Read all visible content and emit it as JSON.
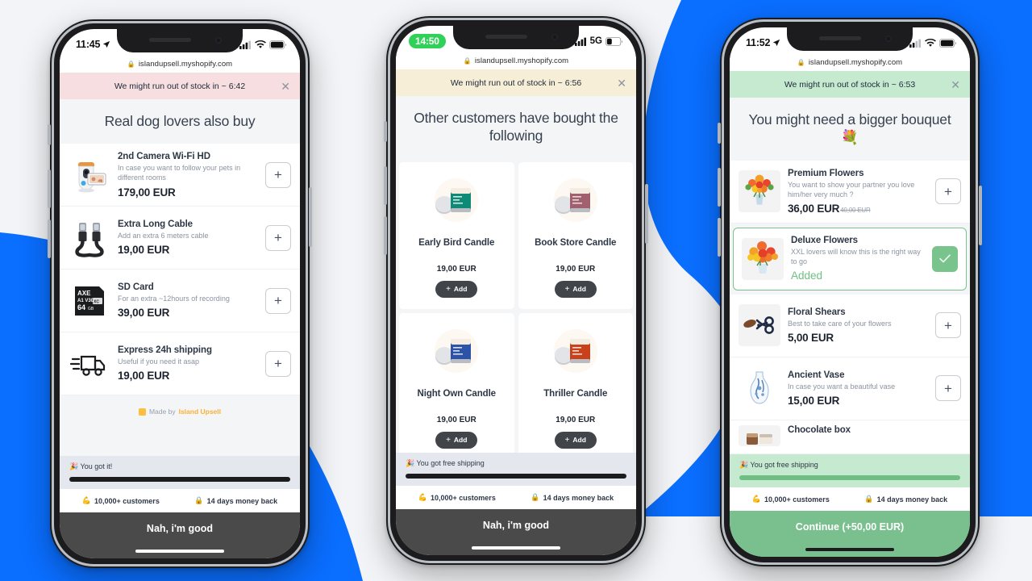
{
  "background": {
    "accent_color": "#0a6eff",
    "page_color": "#f2f4f7"
  },
  "phones": [
    {
      "id": "phone-left",
      "status_bar": {
        "time": "11:45",
        "time_style": "plain",
        "network": "wifi",
        "carrier_label": ""
      },
      "url": "islandupsell.myshopify.com",
      "banner": {
        "text": "We might run out of stock in ~ 6:42",
        "close_label": "✕",
        "color": "#f7dee0"
      },
      "title": "Real dog lovers also buy",
      "layout": "list",
      "items": [
        {
          "name": "2nd Camera Wi-Fi HD",
          "desc": "In case you want to follow your pets in different rooms",
          "price": "179,00 EUR",
          "old_price": "",
          "action": "plus",
          "action_label": "+",
          "image": "pet-camera"
        },
        {
          "name": "Extra Long Cable",
          "desc": "Add an extra 6 meters cable",
          "price": "19,00 EUR",
          "old_price": "",
          "action": "plus",
          "action_label": "+",
          "image": "usb-cable"
        },
        {
          "name": "SD Card",
          "desc": "For an extra ~12hours of recording",
          "price": "39,00 EUR",
          "old_price": "",
          "action": "plus",
          "action_label": "+",
          "image": "sd-card"
        },
        {
          "name": "Express 24h shipping",
          "desc": "Useful if you need it asap",
          "price": "19,00 EUR",
          "old_price": "",
          "action": "plus",
          "action_label": "+",
          "image": "delivery-truck"
        }
      ],
      "made_by": {
        "prefix": "Made by",
        "brand": "Island Upsell",
        "badge": "■"
      },
      "progress": {
        "text": "🎉 You got it!",
        "fill_percent": 100,
        "bar_color": "#1c1c1e",
        "bg_color": "#e4e7ed"
      },
      "trust": [
        {
          "icon": "💪",
          "label": "10,000+ customers"
        },
        {
          "icon": "🔒",
          "label": "14 days money back"
        }
      ],
      "cta": {
        "label": "Nah, i'm good",
        "style": "dark"
      }
    },
    {
      "id": "phone-center",
      "status_bar": {
        "time": "14:50",
        "time_style": "pill",
        "network": "5g",
        "carrier_label": "5G"
      },
      "url": "islandupsell.myshopify.com",
      "banner": {
        "text": "We might run out of stock in ~ 6:56",
        "close_label": "✕",
        "color": "#f7eed8"
      },
      "title": "Other customers have bought the following",
      "layout": "grid",
      "items": [
        {
          "name": "Early Bird Candle",
          "price": "19,00 EUR",
          "action": "add",
          "action_label": "Add",
          "image": "candle-teal"
        },
        {
          "name": "Book Store Candle",
          "price": "19,00 EUR",
          "action": "add",
          "action_label": "Add",
          "image": "candle-mauve"
        },
        {
          "name": "Night Own Candle",
          "price": "19,00 EUR",
          "action": "add",
          "action_label": "Add",
          "image": "candle-blue"
        },
        {
          "name": "Thriller Candle",
          "price": "19,00 EUR",
          "action": "add",
          "action_label": "Add",
          "image": "candle-orange"
        }
      ],
      "progress": {
        "text": "🎉 You got free shipping",
        "fill_percent": 100,
        "bar_color": "#1c1c1e",
        "bg_color": "#e4e7ed"
      },
      "trust": [
        {
          "icon": "💪",
          "label": "10,000+ customers"
        },
        {
          "icon": "🔒",
          "label": "14 days money back"
        }
      ],
      "cta": {
        "label": "Nah, i'm good",
        "style": "dark"
      }
    },
    {
      "id": "phone-right",
      "status_bar": {
        "time": "11:52",
        "time_style": "plain",
        "network": "wifi",
        "carrier_label": ""
      },
      "url": "islandupsell.myshopify.com",
      "banner": {
        "text": "We might run out of stock in ~ 6:53",
        "close_label": "✕",
        "color": "#c5ead0"
      },
      "title": "You might need a bigger bouquet 💐",
      "layout": "list",
      "items": [
        {
          "name": "Premium Flowers",
          "desc": "You want to show your partner you love him/her very much ?",
          "price": "36,00 EUR",
          "old_price": "40,00 EUR",
          "action": "plus",
          "action_label": "+",
          "image": "bouquet-premium"
        },
        {
          "name": "Deluxe Flowers",
          "desc": "XXL lovers will know this is the right way to go",
          "price": "",
          "added_label": "Added",
          "old_price": "",
          "action": "check",
          "action_label": "✓",
          "image": "bouquet-deluxe",
          "selected": true
        },
        {
          "name": "Floral Shears",
          "desc": "Best to take care of your flowers",
          "price": "5,00 EUR",
          "old_price": "",
          "action": "plus",
          "action_label": "+",
          "image": "floral-shears"
        },
        {
          "name": "Ancient Vase",
          "desc": "In case you want a beautiful vase",
          "price": "15,00 EUR",
          "old_price": "",
          "action": "plus",
          "action_label": "+",
          "image": "ancient-vase"
        },
        {
          "name": "Chocolate box",
          "desc": "",
          "price": "",
          "old_price": "",
          "action": "plus",
          "action_label": "+",
          "image": "chocolate-box"
        }
      ],
      "progress": {
        "text": "🎉 You got free shipping",
        "fill_percent": 100,
        "bar_color": "#6fbf83",
        "bg_color": "#c5ead0"
      },
      "trust": [
        {
          "icon": "💪",
          "label": "10,000+ customers"
        },
        {
          "icon": "🔒",
          "label": "14 days money back"
        }
      ],
      "cta": {
        "label": "Continue (+50,00 EUR)",
        "style": "green"
      }
    }
  ]
}
